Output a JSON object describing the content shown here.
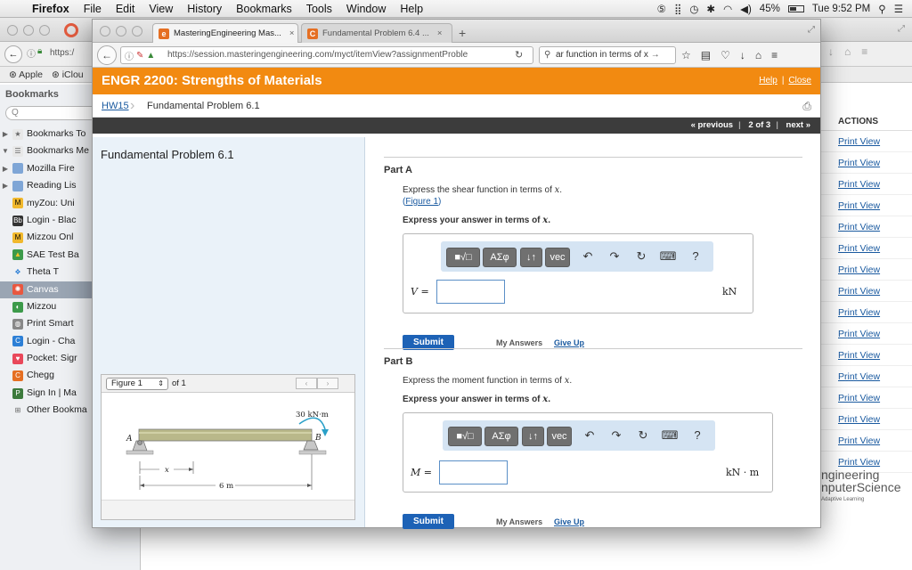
{
  "menubar": {
    "apple": "",
    "app": "Firefox",
    "items": [
      "File",
      "Edit",
      "View",
      "History",
      "Bookmarks",
      "Tools",
      "Window",
      "Help"
    ],
    "battery": "45%",
    "clock": "Tue 9:52 PM"
  },
  "background_window": {
    "url_prefix": "https:/",
    "bookmarks_bar": [
      "Apple",
      "iClou"
    ],
    "sidebar": {
      "title": "Bookmarks",
      "search_placeholder": "Q",
      "items": [
        {
          "label": "Bookmarks To",
          "icon": "star-folder-icon",
          "twisty": "▶"
        },
        {
          "label": "Bookmarks Me",
          "icon": "menu-folder-icon",
          "twisty": "▼"
        },
        {
          "label": "Mozilla Fire",
          "icon": "folder-icon",
          "twisty": "▶"
        },
        {
          "label": "Reading Lis",
          "icon": "folder-icon",
          "twisty": "▶"
        },
        {
          "label": "myZou: Uni",
          "icon": "mizzou-icon",
          "twisty": ""
        },
        {
          "label": "Login - Blac",
          "icon": "blackboard-icon",
          "twisty": ""
        },
        {
          "label": "Mizzou Onl",
          "icon": "mizzou-icon",
          "twisty": ""
        },
        {
          "label": "SAE Test Ba",
          "icon": "drive-icon",
          "twisty": ""
        },
        {
          "label": "Theta T",
          "icon": "dropbox-icon",
          "twisty": ""
        },
        {
          "label": "Canvas",
          "icon": "canvas-icon",
          "twisty": "",
          "selected": true
        },
        {
          "label": "Mizzou",
          "icon": "mizzou-green-icon",
          "twisty": ""
        },
        {
          "label": "Print Smart",
          "icon": "globe-icon",
          "twisty": ""
        },
        {
          "label": "Login - Cha",
          "icon": "c-blue-icon",
          "twisty": ""
        },
        {
          "label": "Pocket: Sigr",
          "icon": "pocket-icon",
          "twisty": ""
        },
        {
          "label": "Chegg",
          "icon": "chegg-icon",
          "twisty": ""
        },
        {
          "label": "Sign In | Ma",
          "icon": "p-green-icon",
          "twisty": ""
        },
        {
          "label": "Other Bookma",
          "icon": "other-bookmarks-icon",
          "twisty": ""
        }
      ]
    },
    "actions": {
      "header": "ACTIONS",
      "items": [
        "Print View",
        "Print View",
        "Print View",
        "Print View",
        "Print View",
        "Print View",
        "Print View",
        "Print View",
        "Print View",
        "Print View",
        "Print View",
        "Print View",
        "Print View",
        "Print View",
        "Print View",
        "Print View"
      ]
    },
    "brand": {
      "line1": "ngineering",
      "line2": "nputerScience",
      "tag": "Adaptive Learning"
    }
  },
  "popup": {
    "tabs": [
      {
        "label": "MasteringEngineering Mas...",
        "icon": "mastering-icon",
        "active": true
      },
      {
        "label": "Fundamental Problem 6.4 ...",
        "icon": "chegg-icon",
        "active": false
      }
    ],
    "new_tab": "+",
    "url": "https://session.masteringengineering.com/myct/itemView?assignmentProble",
    "search_value": "ar function in terms of x",
    "banner": {
      "title": "ENGR 2200: Strengths of Materials",
      "help": "Help",
      "close": "Close"
    },
    "breadcrumb": {
      "hw": "HW15",
      "current": "Fundamental Problem 6.1"
    },
    "pagination": {
      "previous": "« previous",
      "position": "2 of 3",
      "next": "next »"
    },
    "problem_title": "Fundamental Problem 6.1",
    "figure": {
      "select": "Figure 1",
      "of": "of 1",
      "moment_label": "30 kN·m",
      "a": "A",
      "b": "B",
      "x": "x",
      "length": "6 m"
    },
    "partA": {
      "label": "Part A",
      "prompt": "Express the shear function in terms of x.",
      "figure_link": "Figure 1",
      "instruction": "Express your answer in terms of x.",
      "variable": "V =",
      "unit": "kN",
      "submit": "Submit",
      "my_answers": "My Answers",
      "give_up": "Give Up"
    },
    "partB": {
      "label": "Part B",
      "prompt": "Express the moment function in terms of x.",
      "instruction": "Express your answer in terms of x.",
      "variable": "M =",
      "unit": "kN · m",
      "submit": "Submit",
      "my_answers": "My Answers",
      "give_up": "Give Up"
    },
    "toolbar": {
      "templates": "■√□",
      "symbols": "ΑΣφ",
      "sort": "↓↑",
      "vec": "vec",
      "undo": "↶",
      "redo": "↷",
      "reset": "↻",
      "keyboard": "⌨",
      "help": "?"
    }
  }
}
